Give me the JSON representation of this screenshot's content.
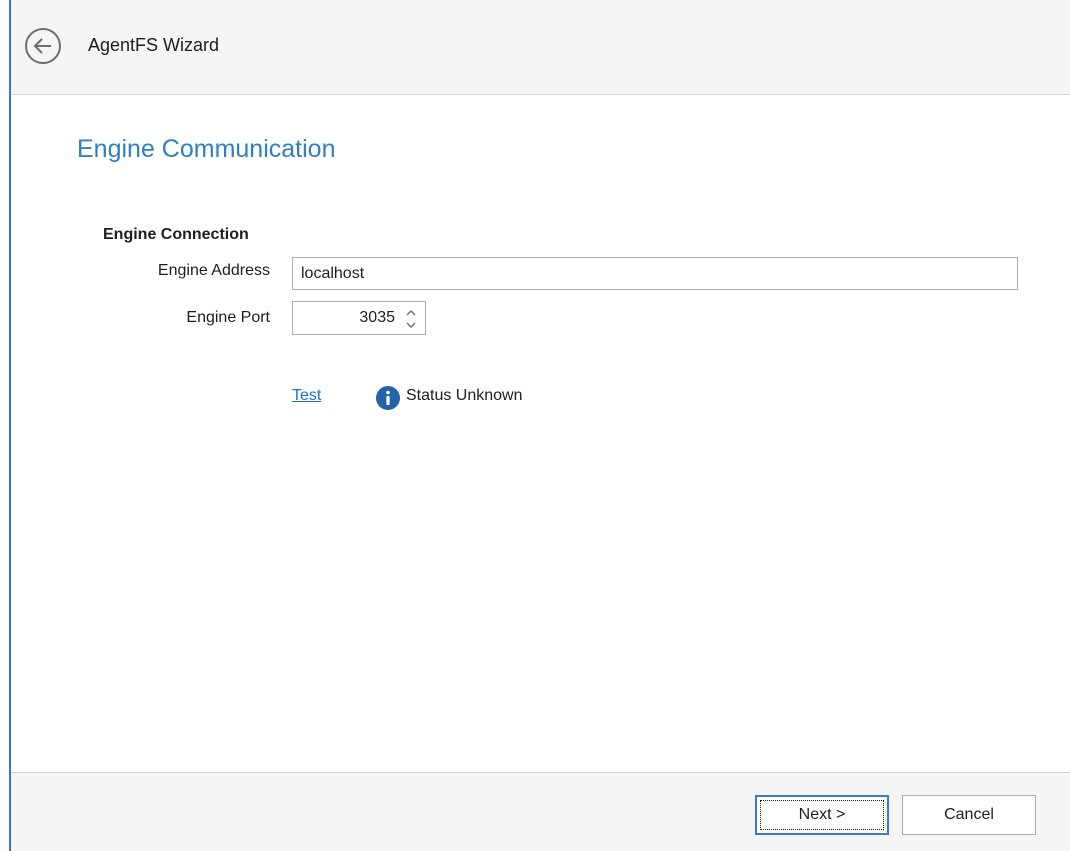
{
  "window": {
    "title": "AgentFS Wizard",
    "back_icon": "arrow-left-circle-icon"
  },
  "page": {
    "title": "Engine Communication"
  },
  "section": {
    "heading": "Engine Connection"
  },
  "fields": {
    "address_label": "Engine Address",
    "address_value": "localhost",
    "port_label": "Engine Port",
    "port_value": "3035"
  },
  "test": {
    "link_label": "Test",
    "status_icon": "info-icon",
    "status_text": "Status Unknown"
  },
  "buttons": {
    "next_label": "Next >",
    "cancel_label": "Cancel"
  },
  "colors": {
    "accent": "#2f7fc1",
    "link": "#1f6fd1",
    "info_icon": "#2563a8"
  }
}
